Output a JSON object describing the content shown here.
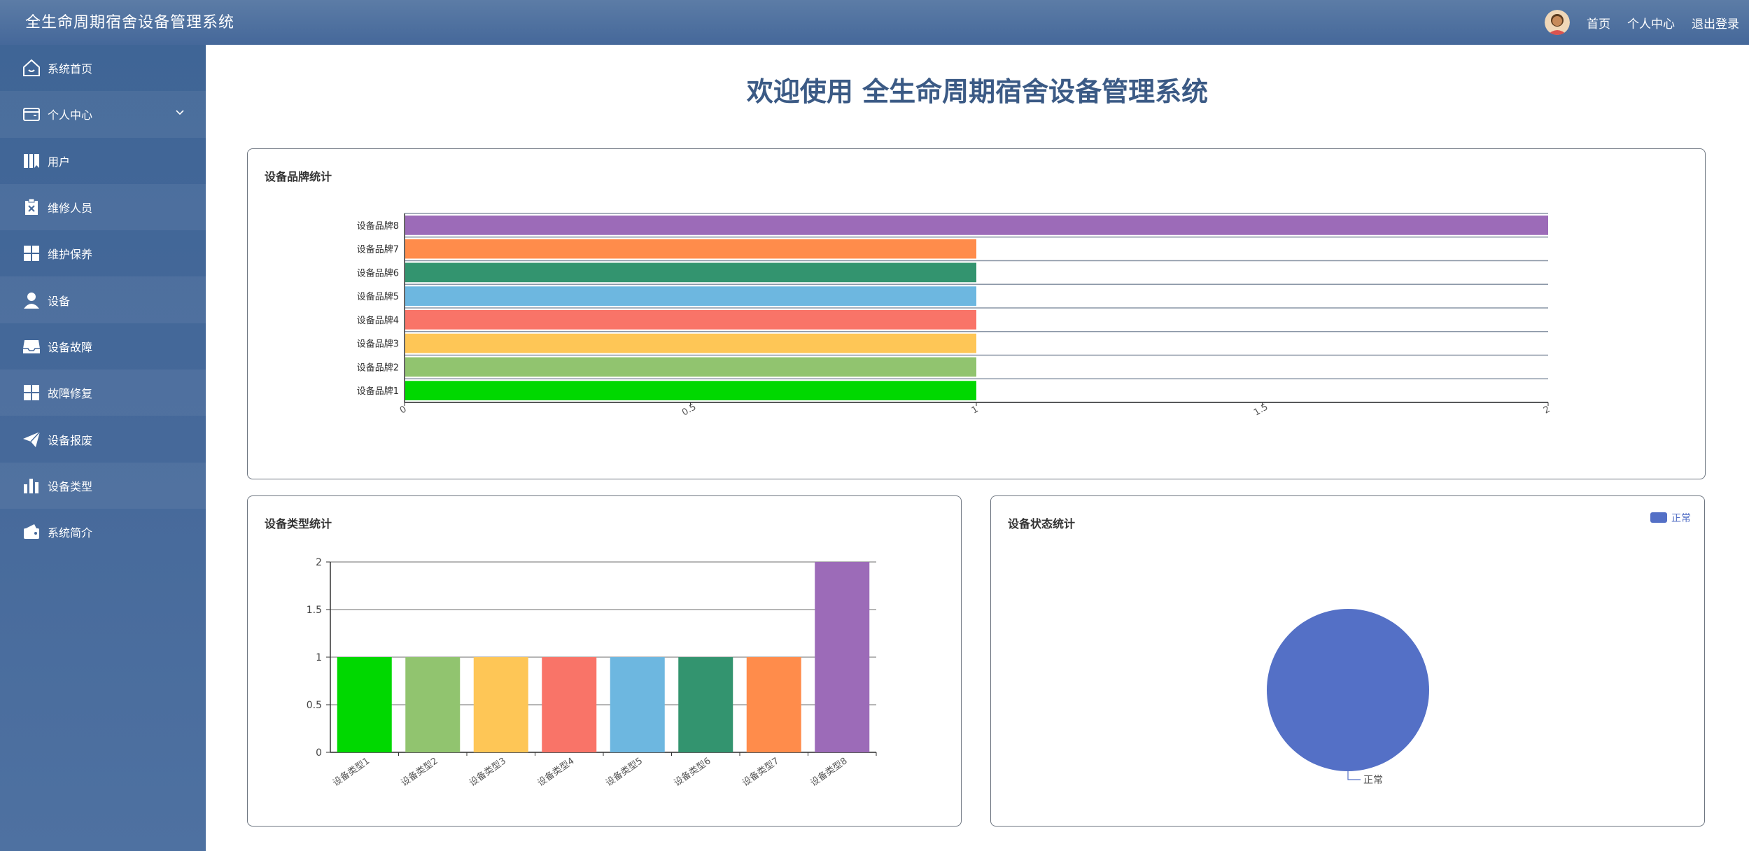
{
  "header": {
    "title": "全生命周期宿舍设备管理系统",
    "links": [
      "首页",
      "个人中心",
      "退出登录"
    ]
  },
  "sidebar": {
    "items": [
      {
        "label": "系统首页",
        "icon": "home-icon"
      },
      {
        "label": "个人中心",
        "icon": "wallet-icon",
        "expandable": true
      },
      {
        "label": "用户",
        "icon": "book-icon"
      },
      {
        "label": "维修人员",
        "icon": "clipboard-icon"
      },
      {
        "label": "维护保养",
        "icon": "grid-icon"
      },
      {
        "label": "设备",
        "icon": "person-icon"
      },
      {
        "label": "设备故障",
        "icon": "inbox-icon"
      },
      {
        "label": "故障修复",
        "icon": "grid-icon"
      },
      {
        "label": "设备报废",
        "icon": "send-icon"
      },
      {
        "label": "设备类型",
        "icon": "bar-chart-icon"
      },
      {
        "label": "系统简介",
        "icon": "wallet-icon"
      }
    ]
  },
  "main": {
    "welcome": "欢迎使用 全生命周期宿舍设备管理系统"
  },
  "chart_data": [
    {
      "type": "bar",
      "orientation": "horizontal",
      "title": "设备品牌统计",
      "categories": [
        "设备品牌1",
        "设备品牌2",
        "设备品牌3",
        "设备品牌4",
        "设备品牌5",
        "设备品牌6",
        "设备品牌7",
        "设备品牌8"
      ],
      "values": [
        1,
        1,
        1,
        1,
        1,
        1,
        1,
        2
      ],
      "colors": [
        "#00d800",
        "#91c46f",
        "#fec656",
        "#f97468",
        "#6db7e0",
        "#33946f",
        "#ff8c4b",
        "#9c6bb8"
      ],
      "xlim": [
        0,
        2
      ],
      "xticks": [
        "0",
        "0.5",
        "1",
        "1.5",
        "2"
      ]
    },
    {
      "type": "bar",
      "title": "设备类型统计",
      "categories": [
        "设备类型1",
        "设备类型2",
        "设备类型3",
        "设备类型4",
        "设备类型5",
        "设备类型6",
        "设备类型7",
        "设备类型8"
      ],
      "values": [
        1,
        1,
        1,
        1,
        1,
        1,
        1,
        2
      ],
      "colors": [
        "#00d800",
        "#91c46f",
        "#fec656",
        "#f97468",
        "#6db7e0",
        "#33946f",
        "#ff8c4b",
        "#9c6bb8"
      ],
      "ylim": [
        0,
        2
      ],
      "yticks": [
        "0",
        "0.5",
        "1",
        "1.5",
        "2"
      ],
      "grid": true
    },
    {
      "type": "pie",
      "title": "设备状态统计",
      "slices": [
        {
          "name": "正常",
          "value": 1,
          "color": "#5470c6"
        }
      ],
      "legend": "top-right"
    }
  ]
}
